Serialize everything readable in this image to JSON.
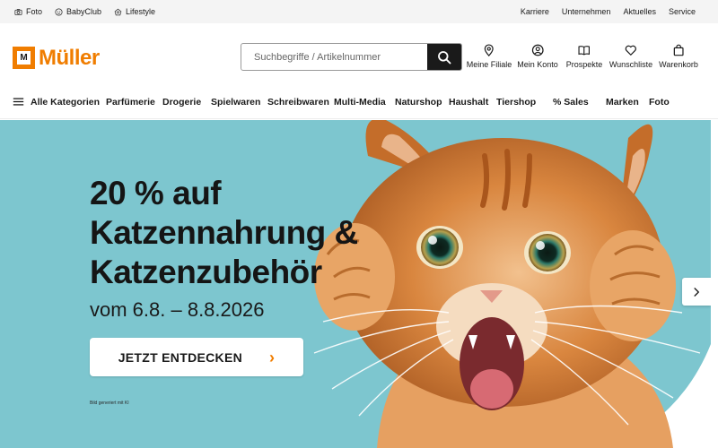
{
  "topbar": {
    "left": [
      {
        "label": "Foto",
        "icon": "camera-icon"
      },
      {
        "label": "BabyClub",
        "icon": "baby-face-icon"
      },
      {
        "label": "Lifestyle",
        "icon": "lifestyle-icon"
      }
    ],
    "right": [
      "Karriere",
      "Unternehmen",
      "Aktuelles",
      "Service"
    ]
  },
  "logo": {
    "mark": "M",
    "text": "Müller",
    "color": "#f07d00"
  },
  "search": {
    "placeholder": "Suchbegriffe / Artikelnummer",
    "value": "",
    "button_icon": "search-icon"
  },
  "actions": [
    {
      "label": "Meine Filiale",
      "icon": "location-pin-icon"
    },
    {
      "label": "Mein Konto",
      "icon": "user-icon"
    },
    {
      "label": "Prospekte",
      "icon": "open-book-icon"
    },
    {
      "label": "Wunschliste",
      "icon": "heart-icon"
    },
    {
      "label": "Warenkorb",
      "icon": "shopping-bag-icon"
    }
  ],
  "nav": {
    "menu_label": "Alle Kategorien",
    "menu_icon": "hamburger-icon",
    "categories": [
      "Parfümerie",
      "Drogerie",
      "Spielwaren",
      "Schreibwaren",
      "Multi-Media",
      "Naturshop",
      "Haushalt",
      "Tiershop",
      "% Sales",
      "Marken",
      "Foto"
    ]
  },
  "hero": {
    "title_lines": [
      "20 % auf",
      "Katzennahrung &",
      "Katzenzubehör"
    ],
    "subtitle": "vom 6.8. – 8.8.2026",
    "cta_label": "JETZT ENTDECKEN",
    "cta_icon": "chevron-right-icon",
    "disclaimer": "Bild generiert mit KI",
    "next_icon": "chevron-right-icon",
    "background_color": "#7dc6cf",
    "accent_color": "#f07d00"
  }
}
